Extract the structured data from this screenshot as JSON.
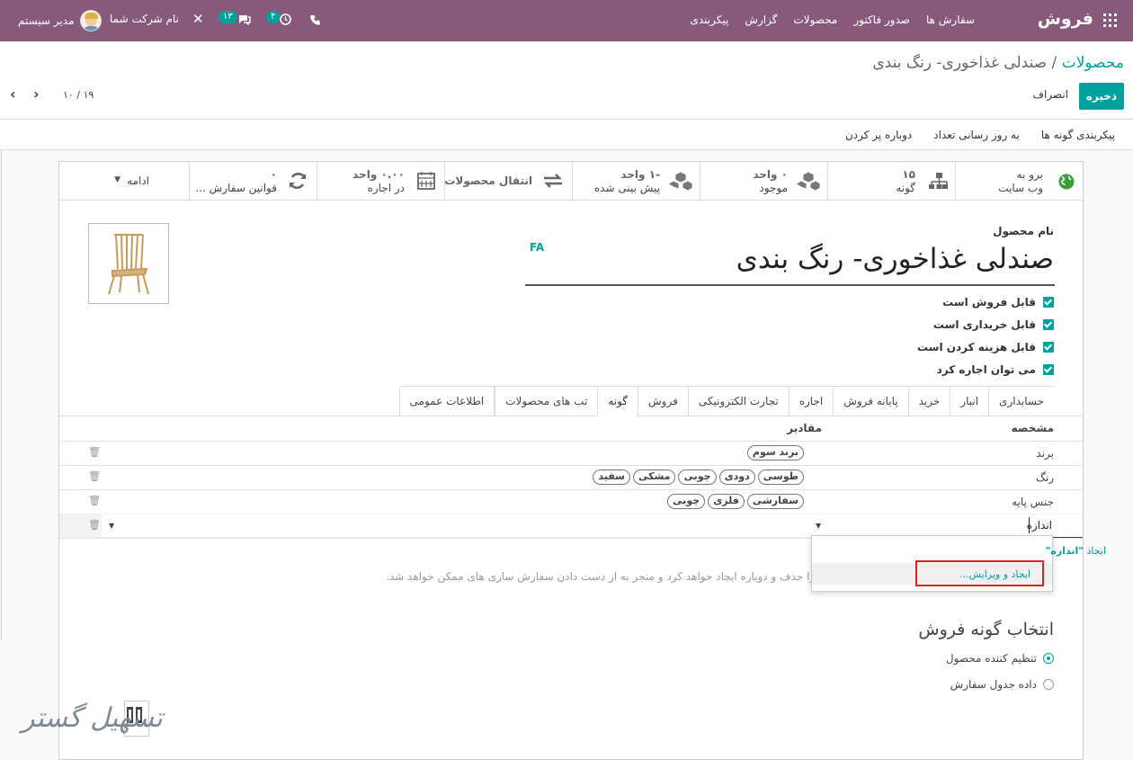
{
  "navbar": {
    "brand": "فروش",
    "menu": [
      "سفارش ها",
      "صدور فاکتور",
      "محصولات",
      "گزارش",
      "پیکربندی"
    ],
    "user_name": "مدیر سیستم",
    "company": "نام شرکت شما",
    "messages_count": "۱۳",
    "activities_count": "۴"
  },
  "breadcrumb": {
    "parent": "محصولات",
    "separator": "/",
    "current": "صندلی غذاخوری- رنگ بندی"
  },
  "control": {
    "save": "ذخیره",
    "discard": "انصراف",
    "pager": "۱۰ / ۱۹"
  },
  "actions": [
    "پیکربندی گونه ها",
    "به روز رسانی تعداد",
    "دوباره پر کردن"
  ],
  "smart_buttons": [
    {
      "line1": "برو به",
      "line2": "وب سایت",
      "icon": "globe-icon"
    },
    {
      "line1": "۱۵",
      "line2": "گونه",
      "icon": "sitemap-icon"
    },
    {
      "line1": "۰ واحد",
      "line2": "موجود",
      "icon": "cubes-icon"
    },
    {
      "line1": "-۱ واحد",
      "line2": "پیش بینی شده",
      "icon": "cubes-icon"
    },
    {
      "line1": "انتقال محصولات",
      "line2": "",
      "icon": "exchange-icon"
    },
    {
      "line1": "۰.۰۰ واحد",
      "line2": "در اجاره",
      "icon": "calendar-icon"
    },
    {
      "line1": "۰",
      "line2": "قوانین سفارش ...",
      "icon": "refresh-icon"
    }
  ],
  "more_label": "ادامه",
  "product": {
    "name_label": "نام محصول",
    "name": "صندلی غذاخوری- رنگ بندی",
    "lang": "FA",
    "checks": [
      "قابل فروش است",
      "قابل خریداری است",
      "قابل هزینه کردن است",
      "می توان اجاره کرد"
    ]
  },
  "tabs": [
    "اطلاعات عمومی",
    "تب های محصولات",
    "گونه",
    "فروش",
    "تجارت الکترونیکی",
    "اجاره",
    "پایانه فروش",
    "خرید",
    "انبار",
    "حسابداری"
  ],
  "active_tab": "گونه",
  "attributes": {
    "col_attr": "مشخصه",
    "col_values": "مقادیر",
    "rows": [
      {
        "name": "برند",
        "values": [
          "برند سوم"
        ]
      },
      {
        "name": "رنگ",
        "values": [
          "سفید",
          "مشکی",
          "چوبی",
          "دودی",
          "طوسی"
        ]
      },
      {
        "name": "جنس پایه",
        "values": [
          "چوبی",
          "فلزی",
          "سفارشی"
        ]
      }
    ],
    "editing_value": "اندازه"
  },
  "dropdown": {
    "create_prefix": "ایجاد",
    "create_quoted": "\"اندازه\"",
    "create_edit": "ایجاد و ویرایش..."
  },
  "hint_text": "ها را حذف و دوباره ایجاد خواهد کرد و منجر به از دست دادن سفارش سازی های ممکن خواهد شد.",
  "variant_selection": {
    "title": "انتخاب گونه فروش",
    "options": [
      "تنظیم کننده محصول",
      "داده جدول سفارش"
    ],
    "selected": 0
  },
  "watermark": "تسهیل گستر"
}
